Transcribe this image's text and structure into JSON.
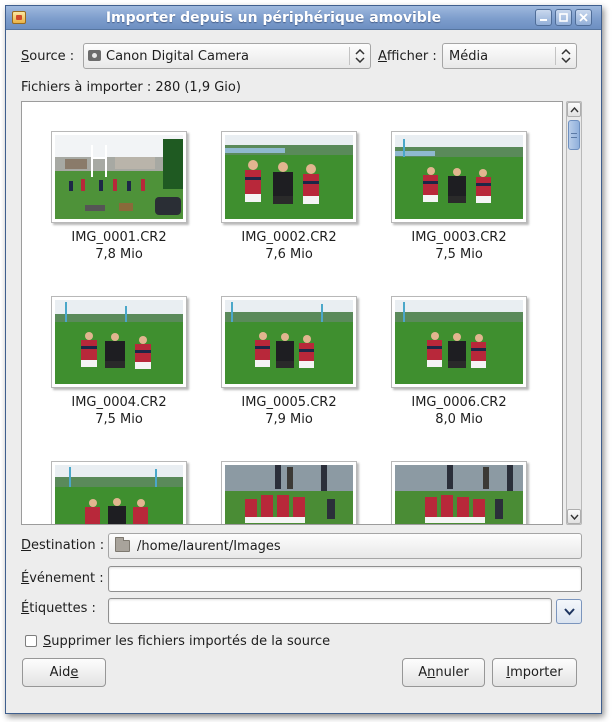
{
  "window": {
    "title": "Importer depuis un périphérique amovible",
    "buttons": {
      "minimize": "minimize-icon",
      "maximize": "maximize-icon",
      "close": "close-icon"
    }
  },
  "source": {
    "label": "Source :",
    "mnemonic": "S",
    "label_rest": "ource :",
    "device_icon": "camera-icon",
    "value": "Canon Digital Camera"
  },
  "show": {
    "mnemonic": "A",
    "label_rest": "fficher :",
    "value": "Média"
  },
  "summary": "Fichiers à importer : 280 (1,9 Gio)",
  "files": [
    {
      "name": "IMG_0001.CR2",
      "size": "7,8 Mio"
    },
    {
      "name": "IMG_0002.CR2",
      "size": "7,6 Mio"
    },
    {
      "name": "IMG_0003.CR2",
      "size": "7,5 Mio"
    },
    {
      "name": "IMG_0004.CR2",
      "size": "7,5 Mio"
    },
    {
      "name": "IMG_0005.CR2",
      "size": "7,9 Mio"
    },
    {
      "name": "IMG_0006.CR2",
      "size": "8,0 Mio"
    }
  ],
  "destination": {
    "mnemonic": "D",
    "label_rest": "estination :",
    "folder_icon": "folder-icon",
    "path": "/home/laurent/Images"
  },
  "event": {
    "mnemonic": "É",
    "label_rest": "vénement :",
    "value": ""
  },
  "tags": {
    "mnemonic": "É",
    "label_rest": "tiquettes :",
    "value": ""
  },
  "delete_option": {
    "mnemonic": "S",
    "label_rest": "upprimer les fichiers importés de la source",
    "checked": false
  },
  "buttons": {
    "help_label_pre": "Aid",
    "help_mnemonic": "e",
    "cancel_label_pre": "A",
    "cancel_mnemonic": "n",
    "cancel_label_post": "nuler",
    "import_mnemonic": "I",
    "import_label_post": "mporter"
  },
  "colors": {
    "titlebar": "#7d9dcc",
    "window_bg": "#ededed",
    "jersey_red": "#b8283a",
    "jersey_navy": "#1d2747",
    "grass": "#3f8f2f",
    "sky": "#e9eef2"
  }
}
